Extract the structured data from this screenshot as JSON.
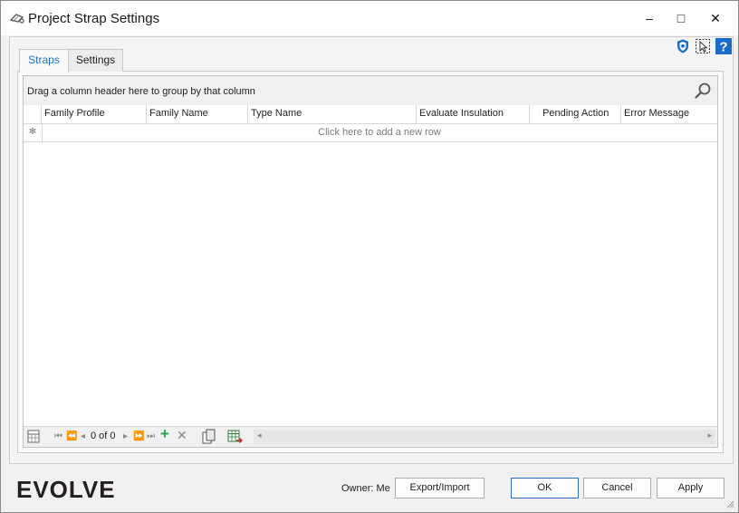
{
  "window": {
    "title": "Project Strap Settings",
    "controls": {
      "minimize": "–",
      "maximize": "□",
      "close": "✕"
    }
  },
  "toolbar_icons": [
    "shield-icon",
    "selection-cursor-icon",
    "help-icon"
  ],
  "tabs": [
    {
      "label": "Straps",
      "active": true
    },
    {
      "label": "Settings",
      "active": false
    }
  ],
  "grid": {
    "group_panel_text": "Drag a column header here to group by that column",
    "columns": [
      "Family Profile",
      "Family Name",
      "Type Name",
      "Evaluate Insulation",
      "Pending Action",
      "Error Message"
    ],
    "new_row_indicator": "✻",
    "new_row_text": "Click here to add a new row",
    "rows": []
  },
  "navigator": {
    "first": "⏮",
    "prev_page": "⏪",
    "prev": "◂",
    "record_position": "0 of 0",
    "next": "▸",
    "next_page": "⏩",
    "last": "⏭",
    "add": "+",
    "remove": "✕",
    "scroll_left": "◂",
    "scroll_right": "▸"
  },
  "footer": {
    "logo": "EVOLVE",
    "owner": "Owner: Me",
    "export_import": "Export/Import",
    "ok": "OK",
    "cancel": "Cancel",
    "apply": "Apply"
  },
  "colors": {
    "accent": "#1e6fb8",
    "help": "#1a6cc8",
    "add_green": "#2aa24a"
  }
}
